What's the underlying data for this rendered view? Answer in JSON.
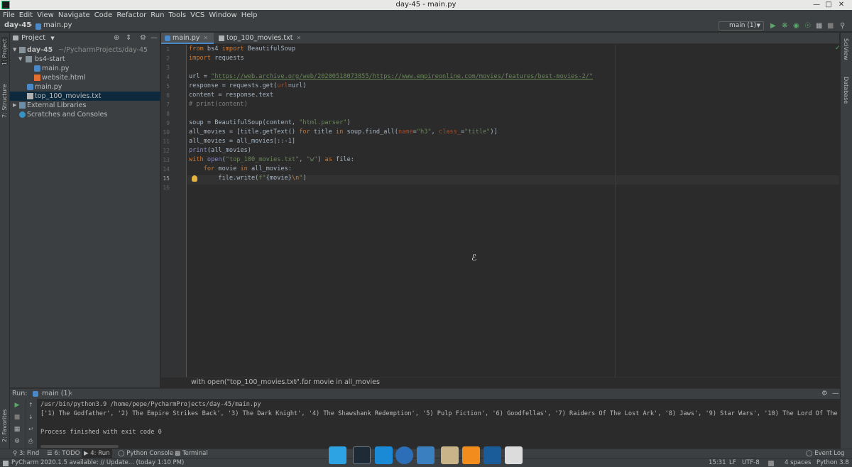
{
  "window": {
    "title": "day-45 - main.py"
  },
  "menu": [
    "File",
    "Edit",
    "View",
    "Navigate",
    "Code",
    "Refactor",
    "Run",
    "Tools",
    "VCS",
    "Window",
    "Help"
  ],
  "nav": {
    "project": "day-45",
    "file": "main.py",
    "run_config": "main (1)"
  },
  "project_panel": {
    "title": "Project",
    "tree": [
      {
        "name": "day-45",
        "path": "~/PycharmProjects/day-45"
      },
      {
        "name": "bs4-start"
      },
      {
        "name": "main.py"
      },
      {
        "name": "website.html"
      },
      {
        "name": "main.py"
      },
      {
        "name": "top_100_movies.txt"
      },
      {
        "name": "External Libraries"
      },
      {
        "name": "Scratches and Consoles"
      }
    ]
  },
  "left_stripe": {
    "project": "1: Project",
    "structure": "7: Structure",
    "favorites": "2: Favorites"
  },
  "right_stripe": {
    "sciview": "SciView",
    "database": "Database"
  },
  "editor": {
    "tabs": [
      "main.py",
      "top_100_movies.txt"
    ],
    "line_numbers": [
      "1",
      "2",
      "3",
      "4",
      "5",
      "6",
      "7",
      "8",
      "9",
      "10",
      "11",
      "12",
      "13",
      "14",
      "15",
      "16"
    ],
    "current_line": "15",
    "breadcrumb": [
      "with open(\"top_100_movies.txt\"....",
      "for movie in all_movies"
    ],
    "code": {
      "l1": [
        "from",
        " bs4 ",
        "import",
        " BeautifulSoup"
      ],
      "l2": [
        "import",
        " requests"
      ],
      "l4a": "url = ",
      "l4b": "\"https://web.archive.org/web/20200518073855/https://www.empireonline.com/movies/features/best-movies-2/\"",
      "l5": [
        "response = requests.get(",
        "url",
        "=url)"
      ],
      "l6": "content = response.text",
      "l7": "# print(content)",
      "l9": [
        "soup = BeautifulSoup(content, ",
        "\"html.parser\"",
        ")"
      ],
      "l10": [
        "all_movies = [title.getText() ",
        "for",
        " title ",
        "in",
        " soup.find_all(",
        "name",
        "=",
        "\"h3\"",
        ", ",
        "class_",
        "=",
        "\"title\"",
        ")]"
      ],
      "l11": "all_movies = all_movies[::-1]",
      "l12": [
        "print",
        "(all_movies)"
      ],
      "l13": [
        "with",
        " ",
        "open",
        "(",
        "\"top_100_movies.txt\"",
        ", ",
        "\"w\"",
        ") ",
        "as",
        " file:"
      ],
      "l14": [
        "    ",
        "for",
        " movie ",
        "in",
        " all_movies:"
      ],
      "l15": [
        "        file.write(",
        "f\"",
        "{movie}",
        "\\n",
        "\"",
        ")"
      ]
    }
  },
  "run": {
    "label": "Run:",
    "tab": "main (1)",
    "output": [
      "/usr/bin/python3.9 /home/pepe/PycharmProjects/day-45/main.py",
      "['1) The Godfather', '2) The Empire Strikes Back', '3) The Dark Knight', '4) The Shawshank Redemption', '5) Pulp Fiction', '6) Goodfellas', '7) Raiders Of The Lost Ark', '8) Jaws', '9) Star Wars', '10) The Lord Of The Rings: T",
      "",
      "Process finished with exit code 0"
    ]
  },
  "tool_windows": [
    "3: Find",
    "6: TODO",
    "4: Run",
    "Python Console",
    "Terminal",
    "Event Log"
  ],
  "status": {
    "message": "PyCharm 2020.1.5 available: // Update... (today 1:10 PM)",
    "position": "15:31",
    "line_sep": "LF",
    "encoding": "UTF-8",
    "indent": "4 spaces",
    "interpreter": "Python 3.8"
  },
  "colors": {
    "accent": "#4a88c7",
    "keyword": "#cc7832",
    "string": "#6a8759",
    "comment": "#808080",
    "background": "#2b2b2b",
    "panel": "#3c3f41"
  }
}
